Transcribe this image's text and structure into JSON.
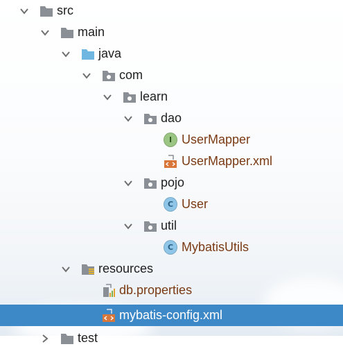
{
  "tree": {
    "rows": [
      {
        "label": "src",
        "kind": "folder-gray"
      },
      {
        "label": "main",
        "kind": "folder-gray"
      },
      {
        "label": "java",
        "kind": "folder-blue"
      },
      {
        "label": "com",
        "kind": "package"
      },
      {
        "label": "learn",
        "kind": "package"
      },
      {
        "label": "dao",
        "kind": "package"
      },
      {
        "label": "UserMapper",
        "kind": "interface",
        "badge": "I"
      },
      {
        "label": "UserMapper.xml",
        "kind": "xml"
      },
      {
        "label": "pojo",
        "kind": "package"
      },
      {
        "label": "User",
        "kind": "class",
        "badge": "C"
      },
      {
        "label": "util",
        "kind": "package"
      },
      {
        "label": "MybatisUtils",
        "kind": "class",
        "badge": "C"
      },
      {
        "label": "resources",
        "kind": "resources-folder"
      },
      {
        "label": "db.properties",
        "kind": "properties"
      },
      {
        "label": "mybatis-config.xml",
        "kind": "xml",
        "selected": true
      },
      {
        "label": "test",
        "kind": "folder-gray"
      }
    ]
  },
  "colors": {
    "selection": "#3d88c6",
    "folder_gray": "#8a8f95",
    "folder_blue": "#6fb6e0",
    "file_text": "#7a3a13"
  }
}
